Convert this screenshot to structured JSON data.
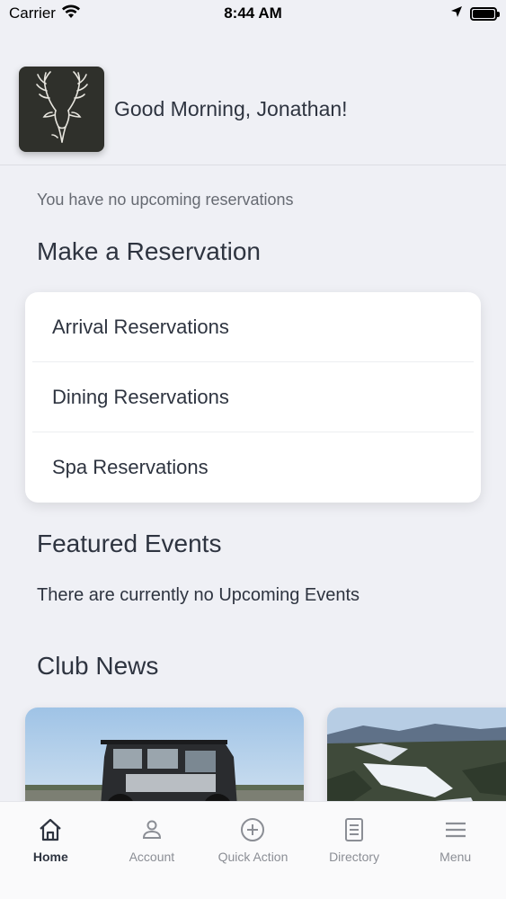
{
  "status_bar": {
    "carrier": "Carrier",
    "time": "8:44 AM"
  },
  "header": {
    "greeting": "Good Morning, Jonathan!",
    "logo_icon": "deer-antlers-icon"
  },
  "reservations": {
    "empty_message": "You have no upcoming reservations",
    "title": "Make a Reservation",
    "items": [
      {
        "label": "Arrival Reservations"
      },
      {
        "label": "Dining Reservations"
      },
      {
        "label": "Spa Reservations"
      }
    ]
  },
  "events": {
    "title": "Featured Events",
    "empty_message": "There are currently no Upcoming Events"
  },
  "news": {
    "title": "Club News"
  },
  "tabbar": {
    "tabs": [
      {
        "label": "Home",
        "icon": "home-icon",
        "active": true
      },
      {
        "label": "Account",
        "icon": "person-icon",
        "active": false
      },
      {
        "label": "Quick Action",
        "icon": "plus-circle-icon",
        "active": false
      },
      {
        "label": "Directory",
        "icon": "document-list-icon",
        "active": false
      },
      {
        "label": "Menu",
        "icon": "hamburger-icon",
        "active": false
      }
    ]
  },
  "colors": {
    "background": "#eff0f5",
    "text_primary": "#2e3440",
    "text_secondary": "#666a72",
    "tab_inactive": "#8b8e95",
    "logo_bg": "#2f302b"
  }
}
